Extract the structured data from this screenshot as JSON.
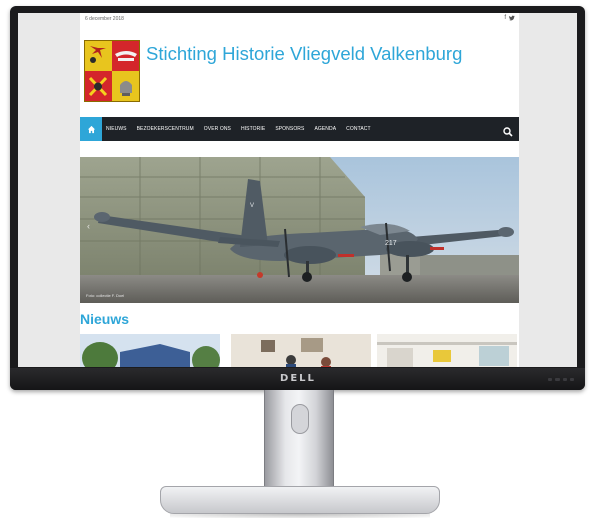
{
  "device": {
    "brand": "DELL"
  },
  "site": {
    "date": "6 december 2018",
    "social_icons": [
      "facebook-icon",
      "twitter-icon"
    ],
    "title": "Stichting Historie Vliegveld Valkenburg",
    "nav": {
      "home_icon": "home-icon",
      "items": [
        "NIEUWS",
        "BEZOEKERSCENTRUM",
        "OVER ONS",
        "HISTORIE",
        "SPONSORS",
        "AGENDA",
        "CONTACT"
      ],
      "search_icon": "search-icon"
    },
    "hero": {
      "caption": "Foto: collectie F. Doel",
      "aircraft_number": "217",
      "tail_marking": "V"
    },
    "news": {
      "heading": "Nieuws"
    }
  },
  "colors": {
    "accent": "#2ea6d8",
    "navbar": "#1e2227",
    "monitor_bezel": "#1b1b1d"
  }
}
